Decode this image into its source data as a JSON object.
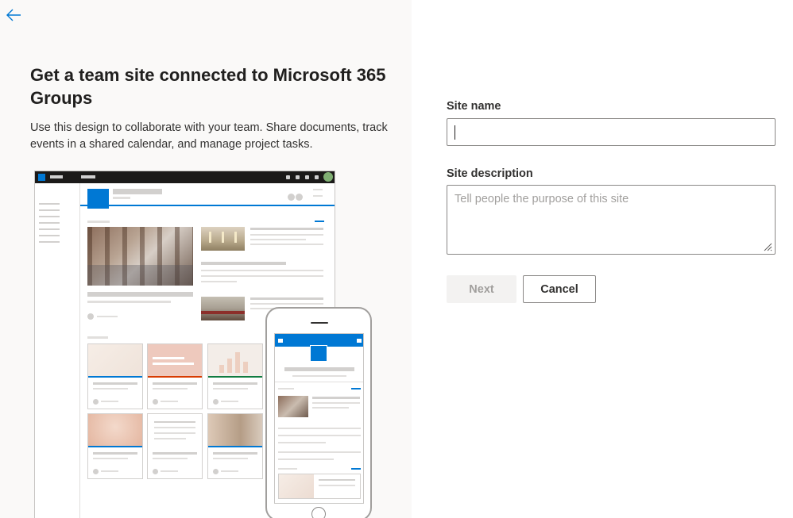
{
  "header": {
    "back_icon": "arrow-left-icon"
  },
  "intro": {
    "title": "Get a team site connected to Microsoft 365 Groups",
    "description": "Use this design to collaborate with your team. Share documents, track events in a shared calendar, and manage project tasks."
  },
  "form": {
    "site_name_label": "Site name",
    "site_name_value": "",
    "site_description_label": "Site description",
    "site_description_placeholder": "Tell people the purpose of this site",
    "next_label": "Next",
    "cancel_label": "Cancel"
  },
  "colors": {
    "accent": "#0078d4",
    "left_panel_bg": "#faf9f8",
    "disabled_button_bg": "#f3f2f1"
  }
}
